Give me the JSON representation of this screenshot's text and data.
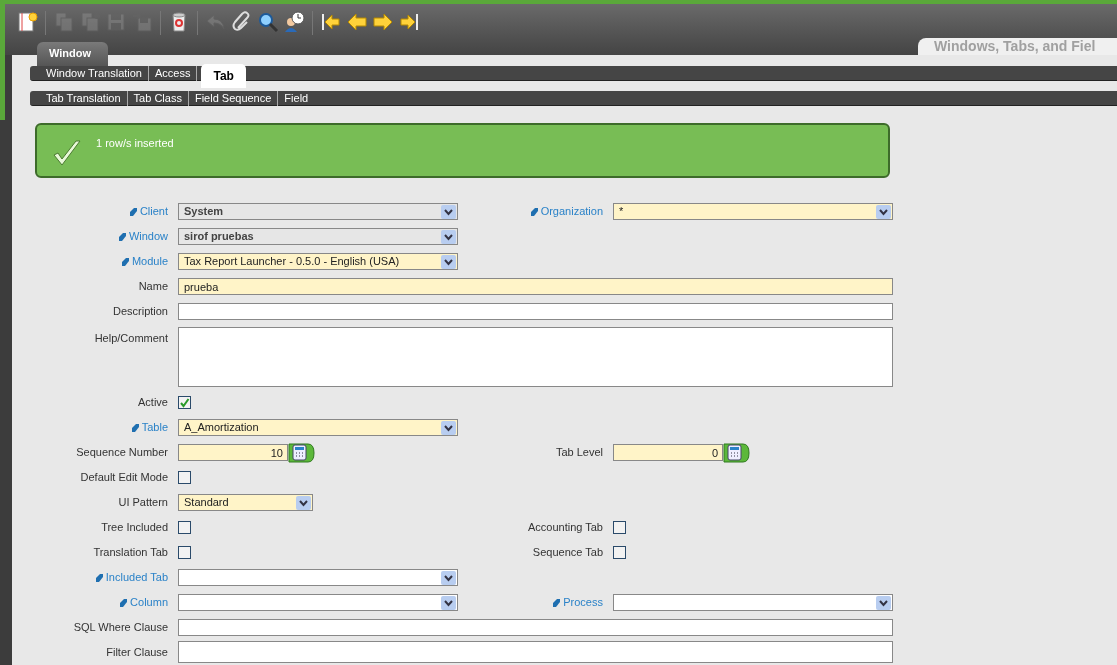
{
  "toolbar": {
    "groups": [
      [
        {
          "kind": "new",
          "disabled": false
        }
      ],
      [
        {
          "kind": "copy",
          "disabled": true
        },
        {
          "kind": "copy-new",
          "disabled": true
        },
        {
          "kind": "save",
          "disabled": true
        },
        {
          "kind": "save-next",
          "disabled": true
        }
      ],
      [
        {
          "kind": "delete",
          "disabled": false
        }
      ],
      [
        {
          "kind": "undo",
          "disabled": true
        },
        {
          "kind": "attach",
          "disabled": false
        },
        {
          "kind": "search",
          "disabled": false
        },
        {
          "kind": "history",
          "disabled": false
        }
      ],
      [
        {
          "kind": "first",
          "disabled": false
        },
        {
          "kind": "previous",
          "disabled": false
        },
        {
          "kind": "next",
          "disabled": false
        },
        {
          "kind": "last",
          "disabled": false
        }
      ]
    ]
  },
  "window_tab": {
    "label": "Window"
  },
  "title_tab": {
    "label": "Windows, Tabs, and Fiel"
  },
  "tabs": [
    {
      "label": "Window Translation",
      "selected": false
    },
    {
      "label": "Access",
      "selected": false
    },
    {
      "label": "Tab",
      "selected": true
    }
  ],
  "subtabs": [
    {
      "label": "Tab Translation"
    },
    {
      "label": "Tab Class"
    },
    {
      "label": "Field Sequence"
    },
    {
      "label": "Field"
    }
  ],
  "message": {
    "text": "1 row/s inserted"
  },
  "form": {
    "rows": [
      {
        "left": {
          "label": "Client",
          "link": true,
          "kind": "locked-select",
          "value": "System"
        },
        "right": {
          "label": "Organization",
          "link": true,
          "kind": "select",
          "value": "*",
          "required": true
        }
      },
      {
        "left": {
          "label": "Window",
          "link": true,
          "kind": "locked-select",
          "value": "sirof pruebas"
        }
      },
      {
        "left": {
          "label": "Module",
          "link": true,
          "kind": "select",
          "value": "Tax Report Launcher - 0.5.0 - English (USA)",
          "required": true
        }
      },
      {
        "left": {
          "label": "Name",
          "link": false,
          "kind": "text",
          "value": "prueba",
          "required": true
        }
      },
      {
        "left": {
          "label": "Description",
          "link": false,
          "kind": "text",
          "required": false
        }
      },
      {
        "left": {
          "label": "Help/Comment",
          "link": false,
          "kind": "textarea",
          "required": false
        }
      },
      {
        "left": {
          "label": "Active",
          "link": false,
          "kind": "checkbox",
          "checked": true
        }
      },
      {
        "left": {
          "label": "Table",
          "link": true,
          "kind": "select",
          "value": "A_Amortization",
          "required": true
        }
      },
      {
        "left": {
          "label": "Sequence Number",
          "link": false,
          "kind": "number",
          "value": "10",
          "required": true
        },
        "right": {
          "label": "Tab Level",
          "link": false,
          "kind": "number",
          "value": "0",
          "required": true
        }
      },
      {
        "left": {
          "label": "Default Edit Mode",
          "link": false,
          "kind": "checkbox",
          "checked": false
        }
      },
      {
        "left": {
          "label": "UI Pattern",
          "link": false,
          "kind": "short-select",
          "value": "Standard",
          "required": true
        }
      },
      {
        "left": {
          "label": "Tree Included",
          "link": false,
          "kind": "checkbox",
          "checked": false
        },
        "right": {
          "label": "Accounting Tab",
          "link": false,
          "kind": "checkbox",
          "checked": false
        }
      },
      {
        "left": {
          "label": "Translation Tab",
          "link": false,
          "kind": "checkbox",
          "checked": false
        },
        "right": {
          "label": "Sequence Tab",
          "link": false,
          "kind": "checkbox",
          "checked": false
        }
      },
      {
        "left": {
          "label": "Included Tab",
          "link": true,
          "kind": "select",
          "required": false
        }
      },
      {
        "left": {
          "label": "Column",
          "link": true,
          "kind": "select",
          "required": false
        },
        "right": {
          "label": "Process",
          "link": true,
          "kind": "select",
          "required": false
        }
      },
      {
        "left": {
          "label": "SQL Where Clause",
          "link": false,
          "kind": "text",
          "required": false
        }
      },
      {
        "left": {
          "label": "Filter Clause",
          "link": false,
          "kind": "textarea-short",
          "required": false
        }
      }
    ]
  }
}
